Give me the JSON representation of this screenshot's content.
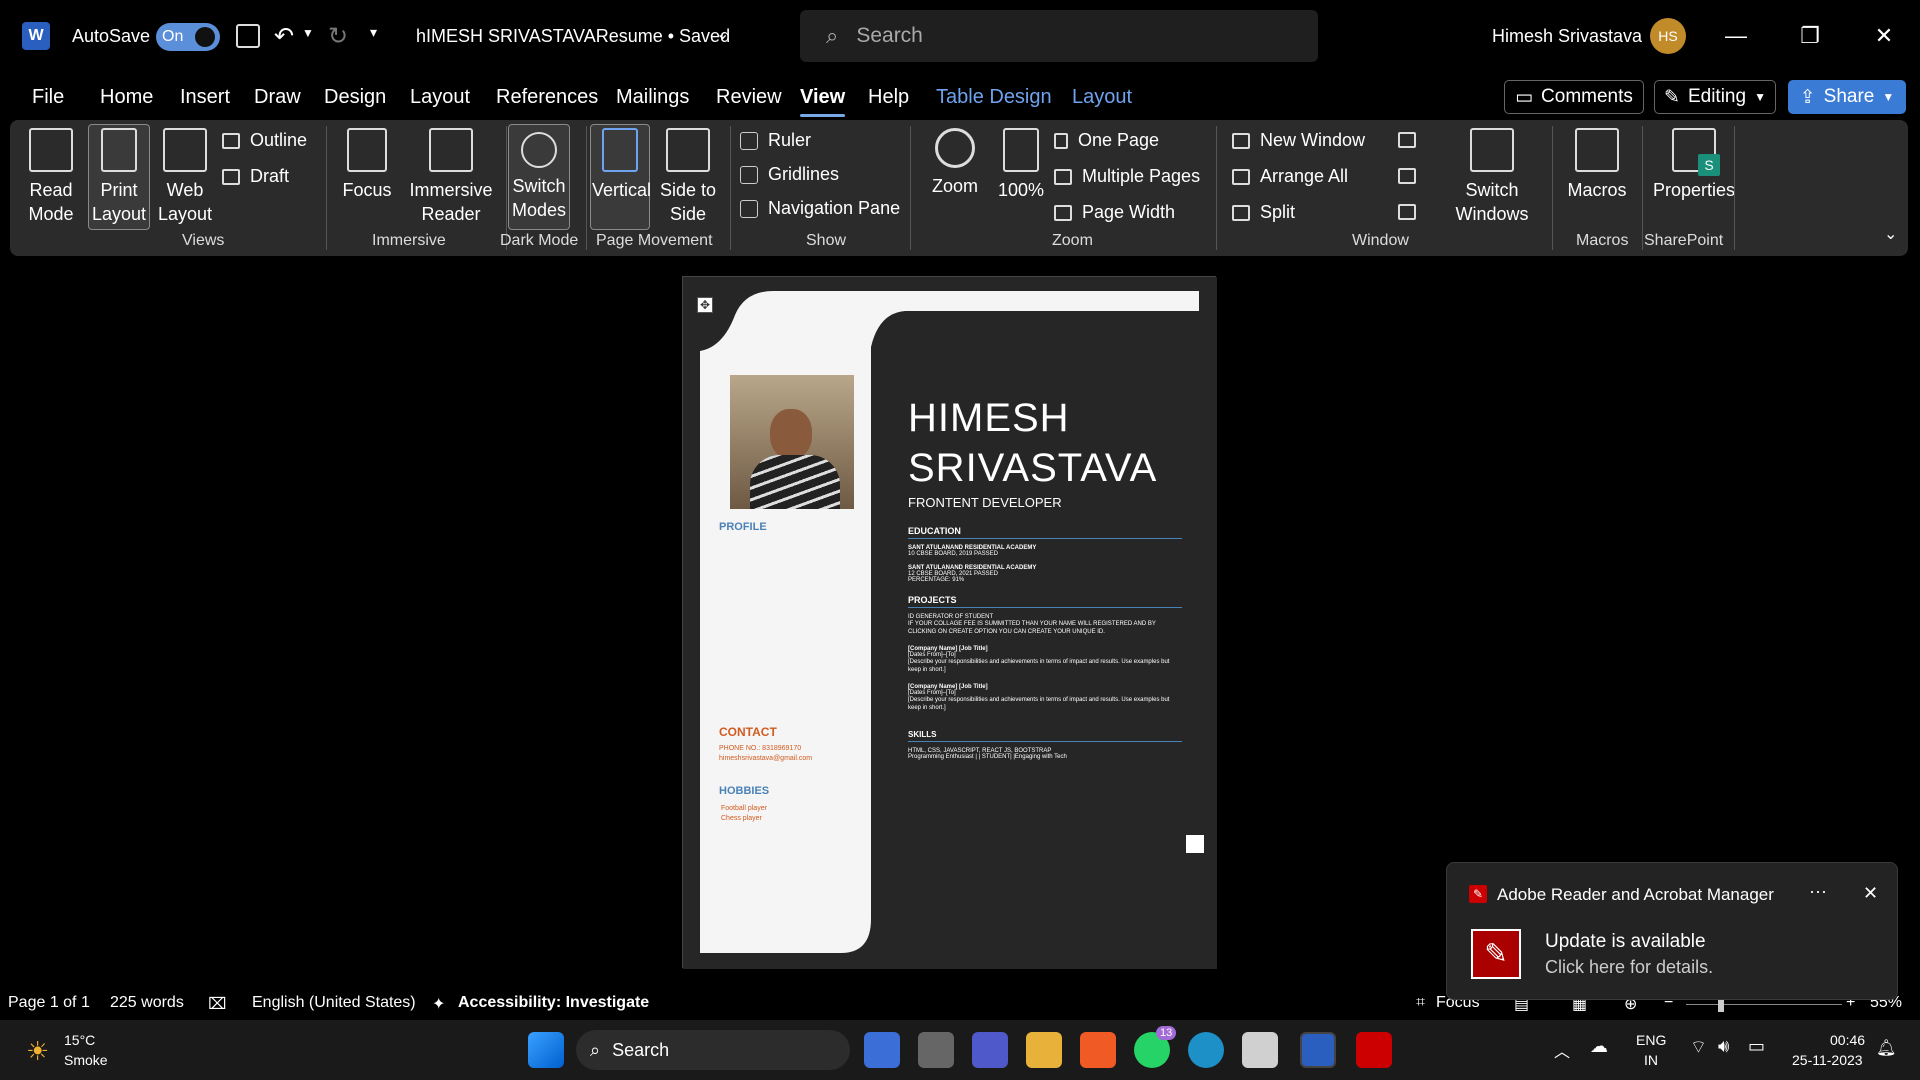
{
  "titlebar": {
    "autosave_label": "AutoSave",
    "toggle_state": "On",
    "doc_title": "hIMESH SRIVASTAVAResume • Saved",
    "search_placeholder": "Search",
    "user_name": "Himesh Srivastava",
    "avatar_initials": "HS"
  },
  "menu": {
    "items": [
      "File",
      "Home",
      "Insert",
      "Draw",
      "Design",
      "Layout",
      "References",
      "Mailings",
      "Review",
      "View",
      "Help",
      "Table Design",
      "Layout"
    ],
    "comments": "Comments",
    "editing": "Editing",
    "share": "Share"
  },
  "ribbon": {
    "views": {
      "read_mode": "Read Mode",
      "print_layout": "Print Layout",
      "web_layout": "Web Layout",
      "outline": "Outline",
      "draft": "Draft",
      "label": "Views"
    },
    "immersive": {
      "focus": "Focus",
      "immersive_reader": "Immersive Reader",
      "label": "Immersive"
    },
    "dark_mode": {
      "switch_modes": "Switch Modes",
      "label": "Dark Mode"
    },
    "page_movement": {
      "vertical": "Vertical",
      "side_to_side": "Side to Side",
      "label": "Page Movement"
    },
    "show": {
      "ruler": "Ruler",
      "gridlines": "Gridlines",
      "navigation_pane": "Navigation Pane",
      "label": "Show"
    },
    "zoom": {
      "zoom": "Zoom",
      "hundred": "100%",
      "one_page": "One Page",
      "multiple_pages": "Multiple Pages",
      "page_width": "Page Width",
      "label": "Zoom"
    },
    "window": {
      "new_window": "New Window",
      "arrange_all": "Arrange All",
      "split": "Split",
      "switch_windows": "Switch Windows",
      "label": "Window"
    },
    "macros": {
      "macros": "Macros",
      "label": "Macros"
    },
    "sharepoint": {
      "properties": "Properties",
      "label": "SharePoint"
    }
  },
  "resume": {
    "name_line1": "HIMESH",
    "name_line2": "SRIVASTAVA",
    "role": "FRONTENT DEVELOPER",
    "education_h": "EDUCATION",
    "edu1_school": "SANT ATULANAND RESIDENTIAL ACADEMY",
    "edu1_detail": "10 CBSE BOARD, 2019 PASSED",
    "edu2_school": "SANT ATULANAND RESIDENTIAL ACADEMY",
    "edu2_detail": "12 CBSE BOARD, 2021 PASSED",
    "edu2_pct": "PERCENTAGE: 91%",
    "projects_h": "PROJECTS",
    "proj1_title": "ID GENERATOR OF STUDENT",
    "proj1_desc": "IF YOUR COLLAGE FEE IS SUMMITTED THAN YOUR NAME WILL REGISTERED AND BY CLICKING ON CREATE OPTION YOU CAN CREATE YOUR UNIQUE ID.",
    "job1_title": "[Company Name]  [Job Title]",
    "job1_dates": "[Dates From]–[To]",
    "job1_desc": "[Describe your responsibilities and achievements in terms of impact and results. Use examples but keep in short.]",
    "job2_title": "[Company Name]  [Job Title]",
    "job2_dates": "[Dates From]–[To]",
    "job2_desc": "[Describe your responsibilities and achievements in terms of impact and results. Use examples but keep in short.]",
    "skills_h": "SKILLS",
    "skills_line1": "HTML, CSS, JAVASCRIPT, REACT JS, BOOTSTRAP",
    "skills_line2": "Programming Enthusiast | | STUDENT| |Engaging with Tech",
    "profile_h": "PROFILE",
    "contact_h": "CONTACT",
    "phone": "PHONE NO.: 8318969170",
    "email": "himeshsrivastava@gmail.com",
    "hobbies_h": "HOBBIES",
    "hobby1": "Football player",
    "hobby2": "Chess player"
  },
  "status": {
    "page": "Page 1 of 1",
    "words": "225 words",
    "language": "English (United States)",
    "accessibility": "Accessibility: Investigate",
    "focus": "Focus",
    "zoom": "55%"
  },
  "toast": {
    "app": "Adobe Reader and Acrobat Manager",
    "title": "Update is available",
    "body": "Click here for details."
  },
  "taskbar": {
    "temp": "15°C",
    "weather": "Smoke",
    "search": "Search",
    "lang1": "ENG",
    "lang2": "IN",
    "time": "00:46",
    "date": "25-11-2023",
    "whatsapp_badge": "13"
  },
  "colors": {
    "accent": "#3a7bd5",
    "resume_dark": "#262626",
    "resume_blue": "#4a82b8",
    "resume_orange": "#d25b20"
  }
}
